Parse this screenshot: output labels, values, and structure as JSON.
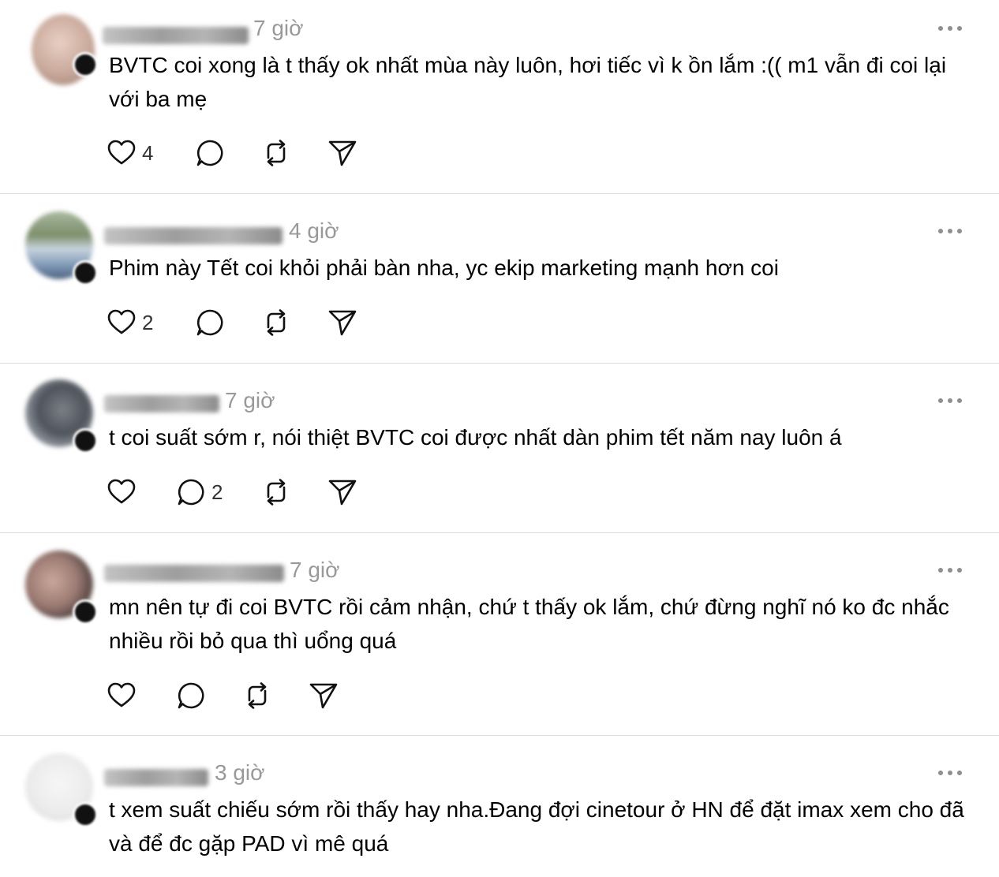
{
  "posts": [
    {
      "time": "7 giờ",
      "text": "BVTC coi xong là t thấy ok nhất mùa này luôn, hơi tiếc vì k ồn lắm :(( m1 vẫn đi coi lại với ba mẹ",
      "likes": "4",
      "replies": ""
    },
    {
      "time": "4 giờ",
      "text": "Phim này Tết coi khỏi phải bàn nha, yc ekip marketing mạnh hơn coi",
      "likes": "2",
      "replies": ""
    },
    {
      "time": "7 giờ",
      "text": "t coi suất sớm r, nói thiệt BVTC coi được nhất dàn phim tết năm nay luôn á",
      "likes": "",
      "replies": "2"
    },
    {
      "time": "7 giờ",
      "text": "mn nên tự đi coi BVTC rồi cảm nhận, chứ t thấy ok lắm, chứ đừng nghĩ nó ko đc nhắc nhiều rồi bỏ qua thì uổng quá",
      "likes": "",
      "replies": ""
    },
    {
      "time": "3 giờ",
      "text": "t xem suất chiếu sớm rồi thấy hay nha.Đang đợi cinetour ở HN để đặt imax xem cho đã và để đc gặp PAD vì mê quá",
      "likes": "",
      "replies": ""
    }
  ],
  "icons": {
    "like": "heart-icon",
    "reply": "comment-bubble-icon",
    "repost": "repost-icon",
    "share": "send-icon",
    "more": "more-dots-icon"
  },
  "colors": {
    "text": "#000000",
    "muted": "#999999",
    "divider": "#dcdcdc",
    "background": "#ffffff"
  }
}
